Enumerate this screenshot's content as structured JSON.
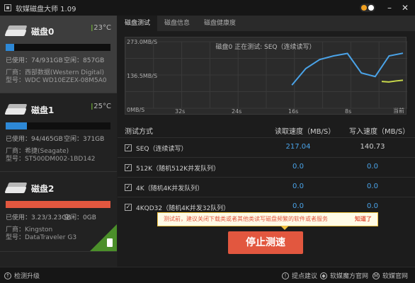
{
  "window": {
    "title": "软媒磁盘大师 1.09"
  },
  "disks": [
    {
      "name": "磁盘0",
      "temp": "23°C",
      "used_label": "已使用：74/931GB",
      "free_label": "空闲：857GB",
      "used_fraction": 0.08,
      "bar_color": "#2d88d6",
      "vendor": "厂商：西部数据(Western Digital)",
      "model": "型号：WDC WD10EZEX-08M5A0"
    },
    {
      "name": "磁盘1",
      "temp": "25°C",
      "used_label": "已使用：94/465GB",
      "free_label": "空闲：371GB",
      "used_fraction": 0.2,
      "bar_color": "#2d88d6",
      "vendor": "厂商：希捷(Seagate)",
      "model": "型号：ST500DM002-1BD142"
    },
    {
      "name": "磁盘2",
      "used_label": "已使用：3.23/3.23GB",
      "free_label": "空闲：0GB",
      "used_fraction": 1.0,
      "bar_color": "#e2573f",
      "vendor": "厂商：Kingston",
      "model": "型号：DataTraveler G3"
    }
  ],
  "tabs": [
    "磁盘测试",
    "磁盘信息",
    "磁盘健康度"
  ],
  "chart": {
    "caption": "磁盘0 正在测试: SEQ（连续读写）",
    "y_top": "273.0MB/S",
    "y_mid": "136.5MB/S",
    "y_bottom": "0MB/S",
    "x_ticks": [
      "32s",
      "24s",
      "16s",
      "8s",
      "当前"
    ]
  },
  "chart_data": {
    "type": "line",
    "ylim": [
      0,
      273
    ],
    "x": [
      -16,
      -14,
      -12,
      -10,
      -8,
      -6,
      -4,
      -2,
      0
    ],
    "series": [
      {
        "values": [
          95,
          163,
          200,
          215,
          225,
          145,
          130,
          215,
          226
        ],
        "color": "#4aa3e8"
      },
      {
        "values": [
          110,
          108,
          112,
          115
        ],
        "color": "#c8d84a"
      }
    ]
  },
  "table": {
    "headers": {
      "method": "测试方式",
      "read": "读取速度（MB/S）",
      "write": "写入速度（MB/S）"
    },
    "rows": [
      {
        "label": "SEQ（连续读写）",
        "read": "217.04",
        "write": "140.73"
      },
      {
        "label": "512K（随机512K并发队列）",
        "read": "0.0",
        "write": "0.0"
      },
      {
        "label": "4K（随机4K并发队列）",
        "read": "0.0",
        "write": "0.0"
      },
      {
        "label": "4KQD32（随机4K并发32队列）",
        "read": "0.0",
        "write": "0.0"
      }
    ]
  },
  "tip": {
    "text": "测试前，建议关闭下载类或者其他类读写磁盘频繁的软件或者服务",
    "ok": "知道了"
  },
  "stop_button": "停止测速",
  "footer": {
    "upgrade": "检测升级",
    "feedback": "提点建议",
    "mofang": "软媒魔方官网",
    "ruanmei": "软媒官网"
  }
}
